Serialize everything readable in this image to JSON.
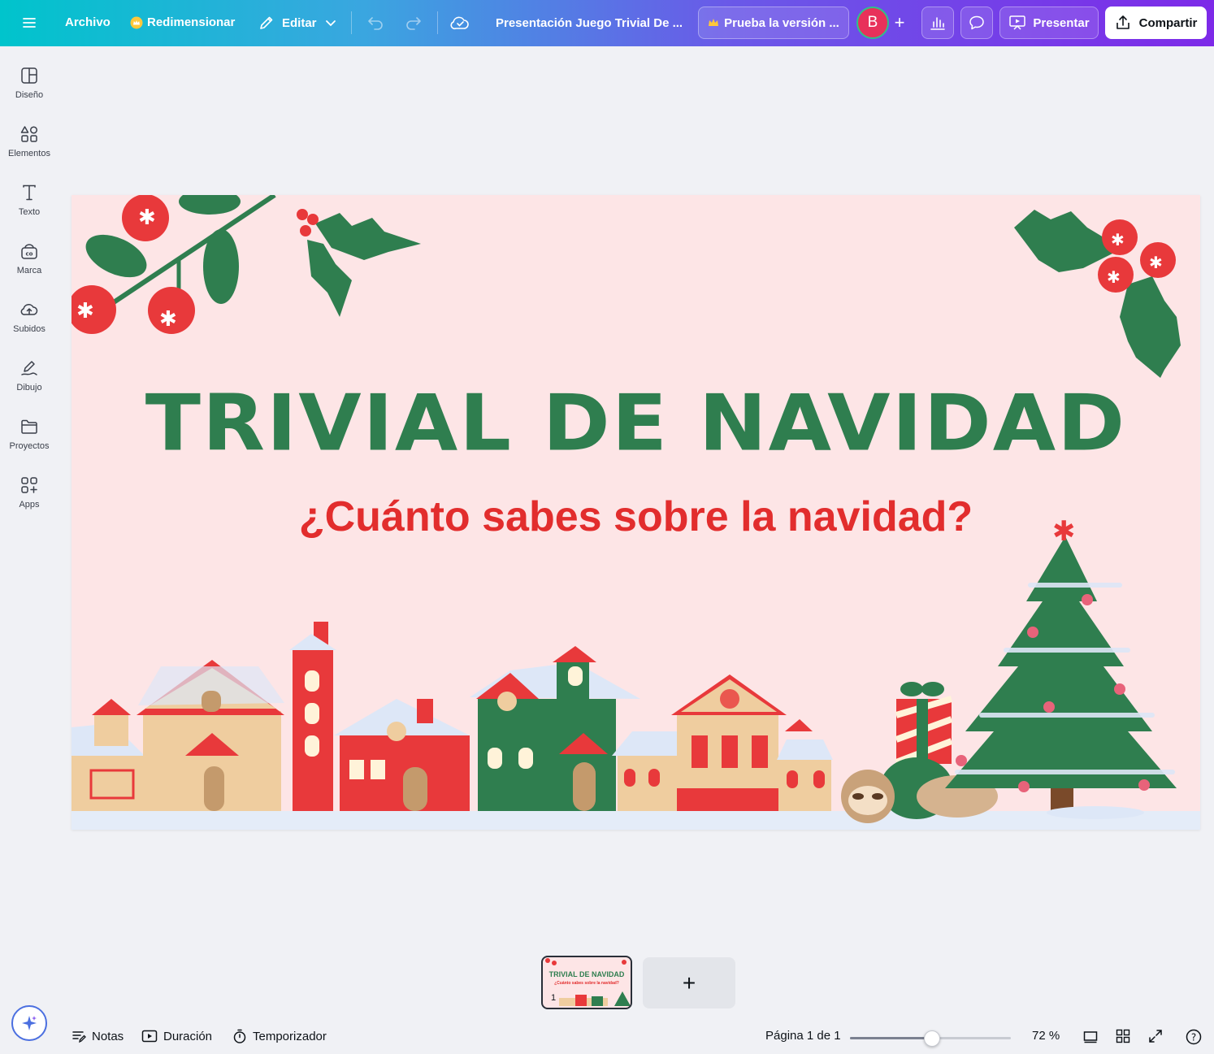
{
  "topbar": {
    "menu_icon": "hamburger-icon",
    "file_label": "Archivo",
    "resize_label": "Redimensionar",
    "edit_label": "Editar",
    "doc_title": "Presentación Juego Trivial De ...",
    "trial_label": "Prueba la versión ...",
    "avatar_initial": "B",
    "present_label": "Presentar",
    "share_label": "Compartir",
    "colors": {
      "gradient_start": "#00c4cc",
      "gradient_end": "#7d2ae8",
      "avatar": "#e8315a"
    }
  },
  "sidebar": {
    "items": [
      {
        "label": "Diseño",
        "icon": "design-icon"
      },
      {
        "label": "Elementos",
        "icon": "elements-icon"
      },
      {
        "label": "Texto",
        "icon": "text-icon"
      },
      {
        "label": "Marca",
        "icon": "brand-icon"
      },
      {
        "label": "Subidos",
        "icon": "upload-cloud-icon"
      },
      {
        "label": "Dibujo",
        "icon": "draw-icon"
      },
      {
        "label": "Proyectos",
        "icon": "folder-icon"
      },
      {
        "label": "Apps",
        "icon": "apps-icon"
      }
    ]
  },
  "slide": {
    "title": "TRIVIAL DE NAVIDAD",
    "subtitle": "¿Cuánto sabes sobre la navidad?",
    "colors": {
      "background": "#fde5e6",
      "title": "#2f7e4f",
      "subtitle": "#e22d2d"
    }
  },
  "pages": {
    "thumb_title": "TRIVIAL DE NAVIDAD",
    "thumb_subtitle": "¿Cuánto sabes sobre la navidad?",
    "thumb_number": "1",
    "add_label": "+"
  },
  "bottombar": {
    "notes_label": "Notas",
    "duration_label": "Duración",
    "timer_label": "Temporizador",
    "page_indicator": "Página 1 de 1",
    "zoom_label": "72 %",
    "zoom_fraction": 0.51
  }
}
